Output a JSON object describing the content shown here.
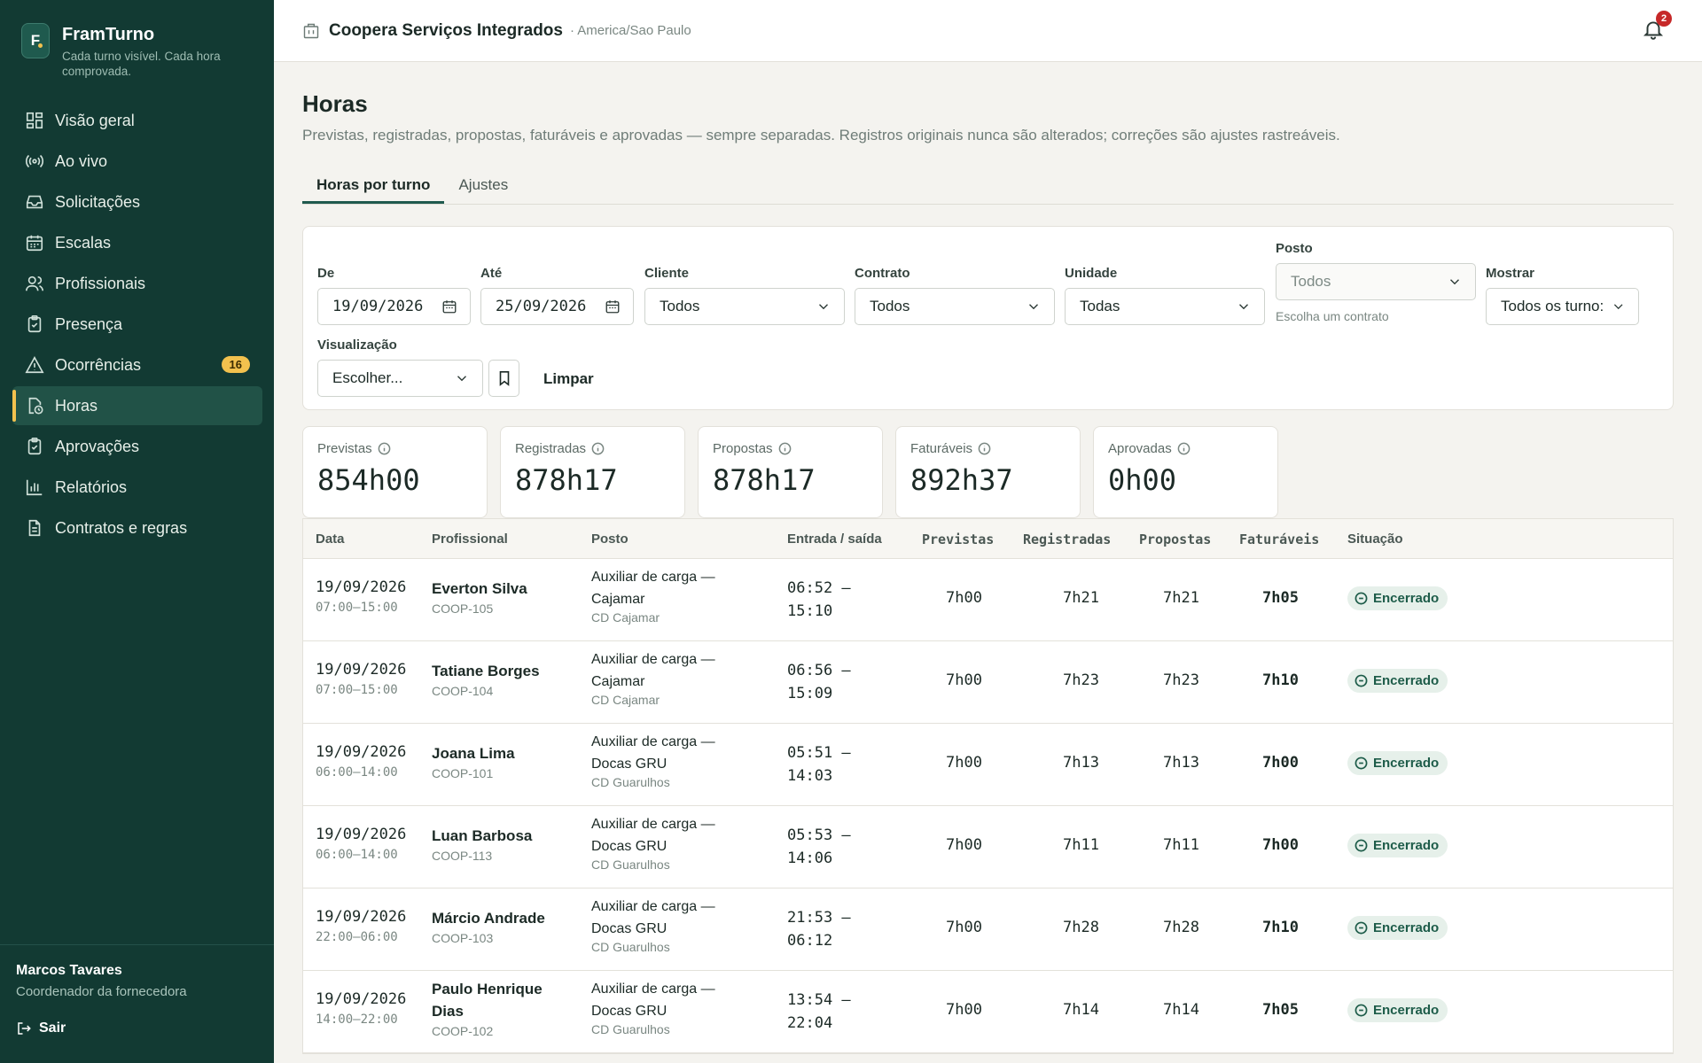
{
  "brand": {
    "name": "FramTurno",
    "logo_letter": "F",
    "tagline": "Cada turno visível. Cada hora comprovada."
  },
  "nav": [
    {
      "label": "Visão geral",
      "icon": "grid-icon"
    },
    {
      "label": "Ao vivo",
      "icon": "broadcast-icon"
    },
    {
      "label": "Solicitações",
      "icon": "inbox-icon"
    },
    {
      "label": "Escalas",
      "icon": "calendar-icon"
    },
    {
      "label": "Profissionais",
      "icon": "users-icon"
    },
    {
      "label": "Presença",
      "icon": "clipboard-check-icon"
    },
    {
      "label": "Ocorrências",
      "icon": "warning-icon",
      "badge": "16"
    },
    {
      "label": "Horas",
      "icon": "clock-file-icon",
      "active": true
    },
    {
      "label": "Aprovações",
      "icon": "clipboard-check-icon"
    },
    {
      "label": "Relatórios",
      "icon": "bar-chart-icon"
    },
    {
      "label": "Contratos e regras",
      "icon": "document-icon"
    }
  ],
  "user": {
    "name": "Marcos Tavares",
    "role": "Coordenador da fornecedora",
    "logout": "Sair"
  },
  "header": {
    "org": "Coopera Serviços Integrados",
    "timezone": "· America/Sao Paulo",
    "notifications": "2"
  },
  "page": {
    "title": "Horas",
    "subtitle": "Previstas, registradas, propostas, faturáveis e aprovadas — sempre separadas. Registros originais nunca são alterados; correções são ajustes rastreáveis."
  },
  "tabs": [
    "Horas por turno",
    "Ajustes"
  ],
  "filters": {
    "from_label": "De",
    "from_value": "19/09/2026",
    "to_label": "Até",
    "to_value": "25/09/2026",
    "client_label": "Cliente",
    "client_value": "Todos",
    "contract_label": "Contrato",
    "contract_value": "Todos",
    "unit_label": "Unidade",
    "unit_value": "Todas",
    "post_label": "Posto",
    "post_value": "Todos",
    "post_hint": "Escolha um contrato",
    "show_label": "Mostrar",
    "show_value": "Todos os turno:",
    "view_label": "Visualização",
    "view_value": "Escolher...",
    "clear": "Limpar"
  },
  "kpis": [
    {
      "label": "Previstas",
      "value": "854h00"
    },
    {
      "label": "Registradas",
      "value": "878h17"
    },
    {
      "label": "Propostas",
      "value": "878h17"
    },
    {
      "label": "Faturáveis",
      "value": "892h37"
    },
    {
      "label": "Aprovadas",
      "value": "0h00"
    }
  ],
  "table": {
    "headers": [
      "Data",
      "Profissional",
      "Posto",
      "Entrada / saída",
      "Previstas",
      "Registradas",
      "Propostas",
      "Faturáveis",
      "Situação"
    ],
    "rows": [
      {
        "date": "19/09/2026",
        "sched": "07:00–15:00",
        "name": "Everton Silva",
        "code": "COOP-105",
        "post": "Auxiliar de carga — Cajamar",
        "unit": "CD Cajamar",
        "in": "06:52 –",
        "out": "15:10",
        "prev": "7h00",
        "reg": "7h21",
        "prop": "7h21",
        "fat": "7h05",
        "status": "Encerrado"
      },
      {
        "date": "19/09/2026",
        "sched": "07:00–15:00",
        "name": "Tatiane Borges",
        "code": "COOP-104",
        "post": "Auxiliar de carga — Cajamar",
        "unit": "CD Cajamar",
        "in": "06:56 –",
        "out": "15:09",
        "prev": "7h00",
        "reg": "7h23",
        "prop": "7h23",
        "fat": "7h10",
        "status": "Encerrado"
      },
      {
        "date": "19/09/2026",
        "sched": "06:00–14:00",
        "name": "Joana Lima",
        "code": "COOP-101",
        "post": "Auxiliar de carga — Docas GRU",
        "unit": "CD Guarulhos",
        "in": "05:51 –",
        "out": "14:03",
        "prev": "7h00",
        "reg": "7h13",
        "prop": "7h13",
        "fat": "7h00",
        "status": "Encerrado"
      },
      {
        "date": "19/09/2026",
        "sched": "06:00–14:00",
        "name": "Luan Barbosa",
        "code": "COOP-113",
        "post": "Auxiliar de carga — Docas GRU",
        "unit": "CD Guarulhos",
        "in": "05:53 –",
        "out": "14:06",
        "prev": "7h00",
        "reg": "7h11",
        "prop": "7h11",
        "fat": "7h00",
        "status": "Encerrado"
      },
      {
        "date": "19/09/2026",
        "sched": "22:00–06:00",
        "name": "Márcio Andrade",
        "code": "COOP-103",
        "post": "Auxiliar de carga — Docas GRU",
        "unit": "CD Guarulhos",
        "in": "21:53 –",
        "out": "06:12",
        "prev": "7h00",
        "reg": "7h28",
        "prop": "7h28",
        "fat": "7h10",
        "status": "Encerrado"
      },
      {
        "date": "19/09/2026",
        "sched": "14:00–22:00",
        "name": "Paulo Henrique Dias",
        "code": "COOP-102",
        "post": "Auxiliar de carga — Docas GRU",
        "unit": "CD Guarulhos",
        "in": "13:54 –",
        "out": "22:04",
        "prev": "7h00",
        "reg": "7h14",
        "prop": "7h14",
        "fat": "7h05",
        "status": "Encerrado"
      }
    ]
  }
}
